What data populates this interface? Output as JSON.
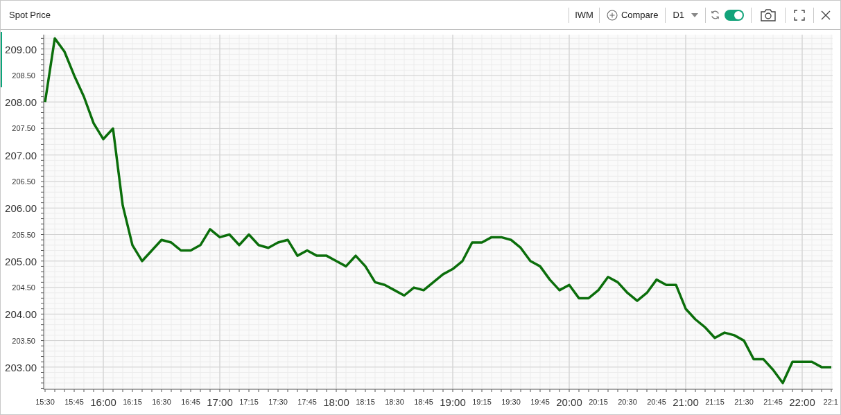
{
  "panel": {
    "title": "Spot Price",
    "symbol": "IWM",
    "compare_button": "Compare",
    "timeframe": "D1",
    "auto_refresh": {
      "on": true
    }
  },
  "chart_data": {
    "type": "line",
    "categories": [
      "15:30",
      null,
      null,
      "15:45",
      null,
      null,
      "16:00",
      null,
      null,
      "16:15",
      null,
      null,
      "16:30",
      null,
      null,
      "16:45",
      null,
      null,
      "17:00",
      null,
      null,
      "17:15",
      null,
      null,
      "17:30",
      null,
      null,
      "17:45",
      null,
      null,
      "18:00",
      null,
      null,
      "18:15",
      null,
      null,
      "18:30",
      null,
      null,
      "18:45",
      null,
      null,
      "19:00",
      null,
      null,
      "19:15",
      null,
      null,
      "19:30",
      null,
      null,
      "19:45",
      null,
      null,
      "20:00",
      null,
      null,
      "20:15",
      null,
      null,
      "20:30",
      null,
      null,
      "20:45",
      null,
      null,
      "21:00",
      null,
      null,
      "21:15",
      null,
      null,
      "21:30",
      null,
      null,
      "21:45",
      null,
      null,
      "22:00",
      null,
      null,
      "22:1"
    ],
    "series": [
      {
        "color": "#0b6e0b",
        "values": [
          208.0,
          209.2,
          208.95,
          208.5,
          208.1,
          207.6,
          207.3,
          207.5,
          206.05,
          205.3,
          205.0,
          205.2,
          205.4,
          205.35,
          205.2,
          205.2,
          205.3,
          205.6,
          205.45,
          205.5,
          205.3,
          205.5,
          205.3,
          205.25,
          205.35,
          205.4,
          205.1,
          205.2,
          205.1,
          205.1,
          205.0,
          204.9,
          205.1,
          204.9,
          204.6,
          204.55,
          204.45,
          204.35,
          204.5,
          204.45,
          204.6,
          204.75,
          204.85,
          205.0,
          205.35,
          205.35,
          205.45,
          205.45,
          205.4,
          205.25,
          205.0,
          204.9,
          204.65,
          204.45,
          204.55,
          204.3,
          204.3,
          204.45,
          204.7,
          204.6,
          204.4,
          204.25,
          204.4,
          204.65,
          204.55,
          204.55,
          204.1,
          203.9,
          203.75,
          203.55,
          203.65,
          203.6,
          203.5,
          203.15,
          203.15,
          202.95,
          202.7,
          203.1,
          203.1,
          203.1,
          203.0,
          203.0
        ]
      }
    ],
    "ylim": [
      202.58,
      209.27
    ],
    "grid": true,
    "yticks": [
      {
        "value": 203,
        "label": "203.00"
      },
      {
        "value": 203.5,
        "label": "203.50"
      },
      {
        "value": 204,
        "label": "204.00"
      },
      {
        "value": 204.5,
        "label": "204.50"
      },
      {
        "value": 205,
        "label": "205.00"
      },
      {
        "value": 205.5,
        "label": "205.50"
      },
      {
        "value": 206,
        "label": "206.00"
      },
      {
        "value": 206.5,
        "label": "206.50"
      },
      {
        "value": 207,
        "label": "207.00"
      },
      {
        "value": 207.5,
        "label": "207.50"
      },
      {
        "value": 208,
        "label": "208.00"
      },
      {
        "value": 208.5,
        "label": "208.50"
      },
      {
        "value": 209,
        "label": "209.00"
      }
    ]
  }
}
